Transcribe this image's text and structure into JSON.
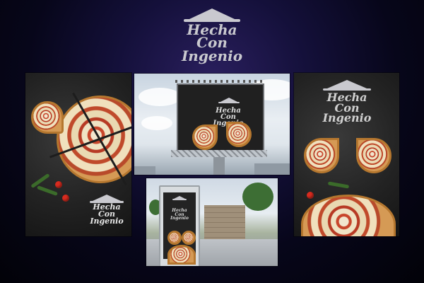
{
  "brand": {
    "line1": "Hecha",
    "line2": "Con",
    "line3": "Ingenio"
  },
  "colors": {
    "background": "#0b0a24",
    "chalkboard": "#232323",
    "logo": "#c9c9cf",
    "sauce": "#c8462c",
    "crust": "#d59a55"
  },
  "icons": {
    "logo": "pizza-hut-roof-icon"
  },
  "mockups": [
    "left-poster-pizza-on-chalkboard",
    "billboard-against-sky",
    "bus-shelter-street-ad",
    "right-poster-bowtie-slices"
  ]
}
